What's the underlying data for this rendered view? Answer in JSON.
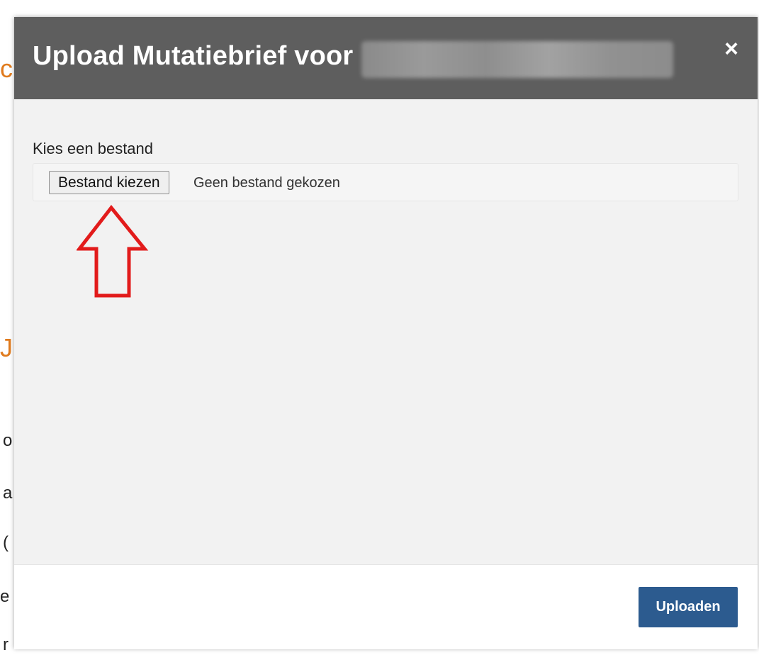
{
  "background": {
    "glyphs": [
      "c",
      "J",
      "o",
      "a",
      "(",
      "e",
      "r"
    ]
  },
  "modal": {
    "title": "Upload Mutatiebrief voor",
    "close_label": "×",
    "form": {
      "label": "Kies een bestand",
      "file_button_label": "Bestand kiezen",
      "file_status": "Geen bestand gekozen"
    },
    "footer": {
      "upload_label": "Uploaden"
    }
  },
  "colors": {
    "header_bg": "#5e5e5e",
    "body_bg": "#f2f2f2",
    "upload_button": "#2c5b8f",
    "annotation_arrow": "#e21b1b",
    "background_accent": "#e07b1e"
  },
  "annotation": {
    "icon": "arrow-up-icon"
  }
}
